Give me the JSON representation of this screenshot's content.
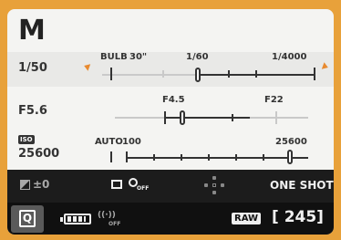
{
  "mode": "M",
  "shutter": {
    "value": "1/50",
    "scale_labels": {
      "bulb": "BULB",
      "long": "30\"",
      "mid": "1/60",
      "fast": "1/4000"
    },
    "accent_color": "#e88a2f"
  },
  "aperture": {
    "value": "F5.6",
    "scale_labels": {
      "min": "F4.5",
      "max": "F22"
    }
  },
  "iso": {
    "icon": "iso-icon",
    "icon_text": "ISO",
    "value": "25600",
    "scale_labels": {
      "auto": "AUTO",
      "min": "100",
      "max": "25600"
    }
  },
  "status_row": {
    "exposure_comp": "±0",
    "drive_icon": "single-shot-icon",
    "self_timer_label": "OFF",
    "af_area_icon": "af-area-icon",
    "af_mode": "ONE SHOT"
  },
  "bottom_row": {
    "quick_menu_label": "Q",
    "battery_icon": "battery-icon",
    "wifi_label": "OFF",
    "image_quality": "RAW",
    "shots_remaining": "[ 245]"
  }
}
